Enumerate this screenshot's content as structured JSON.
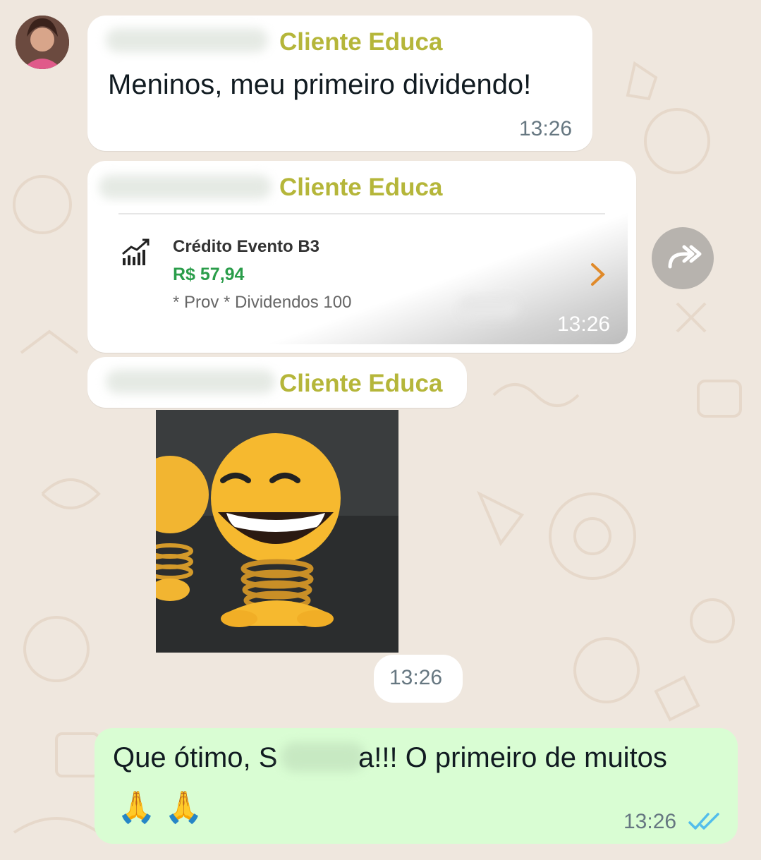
{
  "chat": {
    "sender_group": "Cliente Educa",
    "messages": [
      {
        "text": "Meninos, meu primeiro dividendo!",
        "time": "13:26"
      },
      {
        "card_title": "Crédito Evento B3",
        "card_amount": "R$ 57,94",
        "card_sub": "* Prov * Dividendos 100",
        "time": "13:26"
      },
      {
        "time": "13:26"
      }
    ],
    "reply": {
      "text_before": "Que ótimo, S",
      "text_after": "a!!! O primeiro de muitos",
      "emojis": "🙏 🙏",
      "time": "13:26"
    }
  },
  "icons": {
    "forward": "forward-double-arrow-icon",
    "chart": "trend-chart-icon",
    "chevron": "chevron-right-icon",
    "read_receipt": "double-check-icon"
  },
  "colors": {
    "sender": "#b5b63a",
    "outgoing_bubble": "#d9fdd3",
    "amount": "#2a9d4a",
    "read_tick": "#53bdeb"
  }
}
